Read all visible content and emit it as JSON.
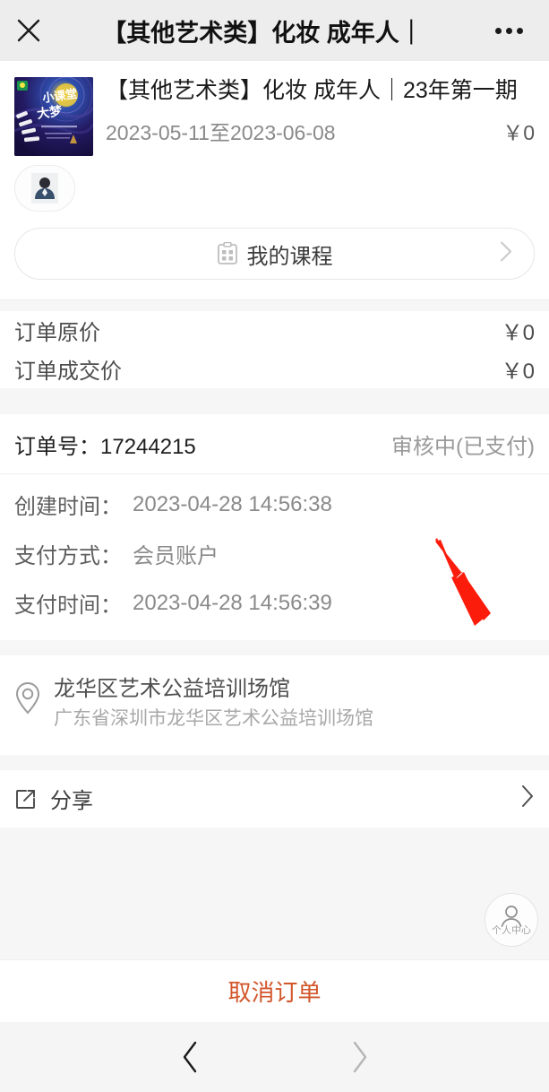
{
  "header": {
    "close_icon": "close-icon",
    "title": "【其他艺术类】化妆 成年人｜",
    "more_icon": "more-icon"
  },
  "product": {
    "thumb_alt": "course-poster",
    "thumb_text_1": "小课堂",
    "thumb_text_2": "大梦想",
    "title": "【其他艺术类】化妆 成年人｜23年第一期",
    "date_range": "2023-05-11至2023-06-08",
    "price": "￥0",
    "avatar_alt": "student-photo"
  },
  "my_course": {
    "icon": "clipboard-icon",
    "label": "我的课程",
    "chevron": "chevron-right-icon"
  },
  "prices": [
    {
      "label": "订单原价",
      "value": "￥0"
    },
    {
      "label": "订单成交价",
      "value": "￥0"
    }
  ],
  "order": {
    "number_label": "订单号：",
    "number": "17244215",
    "status": "审核中(已支付)",
    "meta": [
      {
        "label": "创建时间：",
        "value": "2023-04-28 14:56:38"
      },
      {
        "label": "支付方式：",
        "value": "会员账户"
      },
      {
        "label": "支付时间：",
        "value": "2023-04-28 14:56:39"
      }
    ]
  },
  "location": {
    "icon": "location-pin-icon",
    "name": "龙华区艺术公益培训场馆",
    "address": "广东省深圳市龙华区艺术公益培训场馆"
  },
  "share": {
    "icon": "share-external-icon",
    "label": "分享",
    "chevron": "chevron-right-icon"
  },
  "fab": {
    "icon": "person-icon",
    "label": "个人中心"
  },
  "bottom_action": {
    "cancel_label": "取消订单",
    "cancel_color": "#d2562b"
  },
  "navbar": {
    "back_icon": "chevron-left-icon",
    "forward_icon": "chevron-right-icon"
  },
  "annotation": {
    "arrow_color": "#fb1c0c",
    "arrow_target": "审核中(已支付)"
  }
}
